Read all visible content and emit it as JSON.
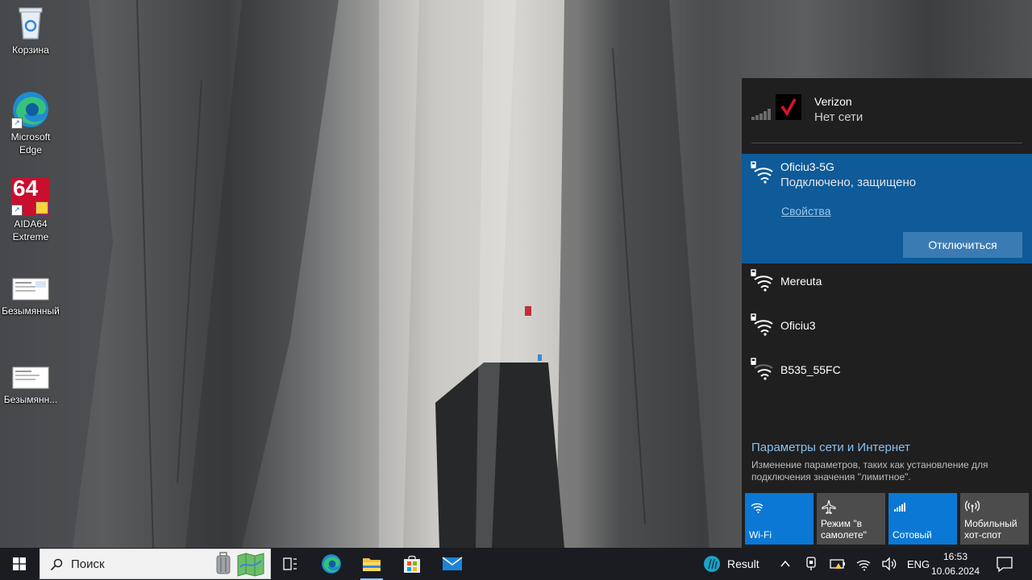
{
  "desktop": {
    "icons": [
      {
        "label": "Корзина"
      },
      {
        "label": "Microsoft Edge"
      },
      {
        "label": "AIDA64 Extreme",
        "badge": "64"
      },
      {
        "label": "Безымянный"
      },
      {
        "label": "Безымянн..."
      }
    ]
  },
  "network_panel": {
    "cellular": {
      "name": "Verizon",
      "status": "Нет сети"
    },
    "connected": {
      "name": "Oficiu3-5G",
      "status": "Подключено, защищено",
      "properties_link": "Свойства",
      "disconnect_button": "Отключиться"
    },
    "networks": [
      {
        "name": "Mereuta"
      },
      {
        "name": "Oficiu3"
      },
      {
        "name": "B535_55FC"
      }
    ],
    "settings_link": "Параметры сети и Интернет",
    "settings_description": "Изменение параметров, таких как установление для подключения значения \"лимитное\".",
    "quick_actions": [
      {
        "label": "Wi-Fi",
        "state": "on",
        "icon": "wifi-icon"
      },
      {
        "label": "Режим \"в самолете\"",
        "state": "off",
        "icon": "airplane-icon"
      },
      {
        "label": "Сотовый",
        "state": "on",
        "icon": "cellular-icon"
      },
      {
        "label": "Мобильный хот-спот",
        "state": "off",
        "icon": "hotspot-icon"
      }
    ]
  },
  "taskbar": {
    "search_placeholder": "Поиск",
    "tray_app_label": "Result",
    "language": "ENG",
    "time": "16:53",
    "date": "10.06.2024"
  },
  "colors": {
    "accent": "#0a78d4",
    "panel_bg": "#1f1f1f",
    "selected_network_bg": "#0f5a98",
    "taskbar_bg": "#1a1c22"
  }
}
